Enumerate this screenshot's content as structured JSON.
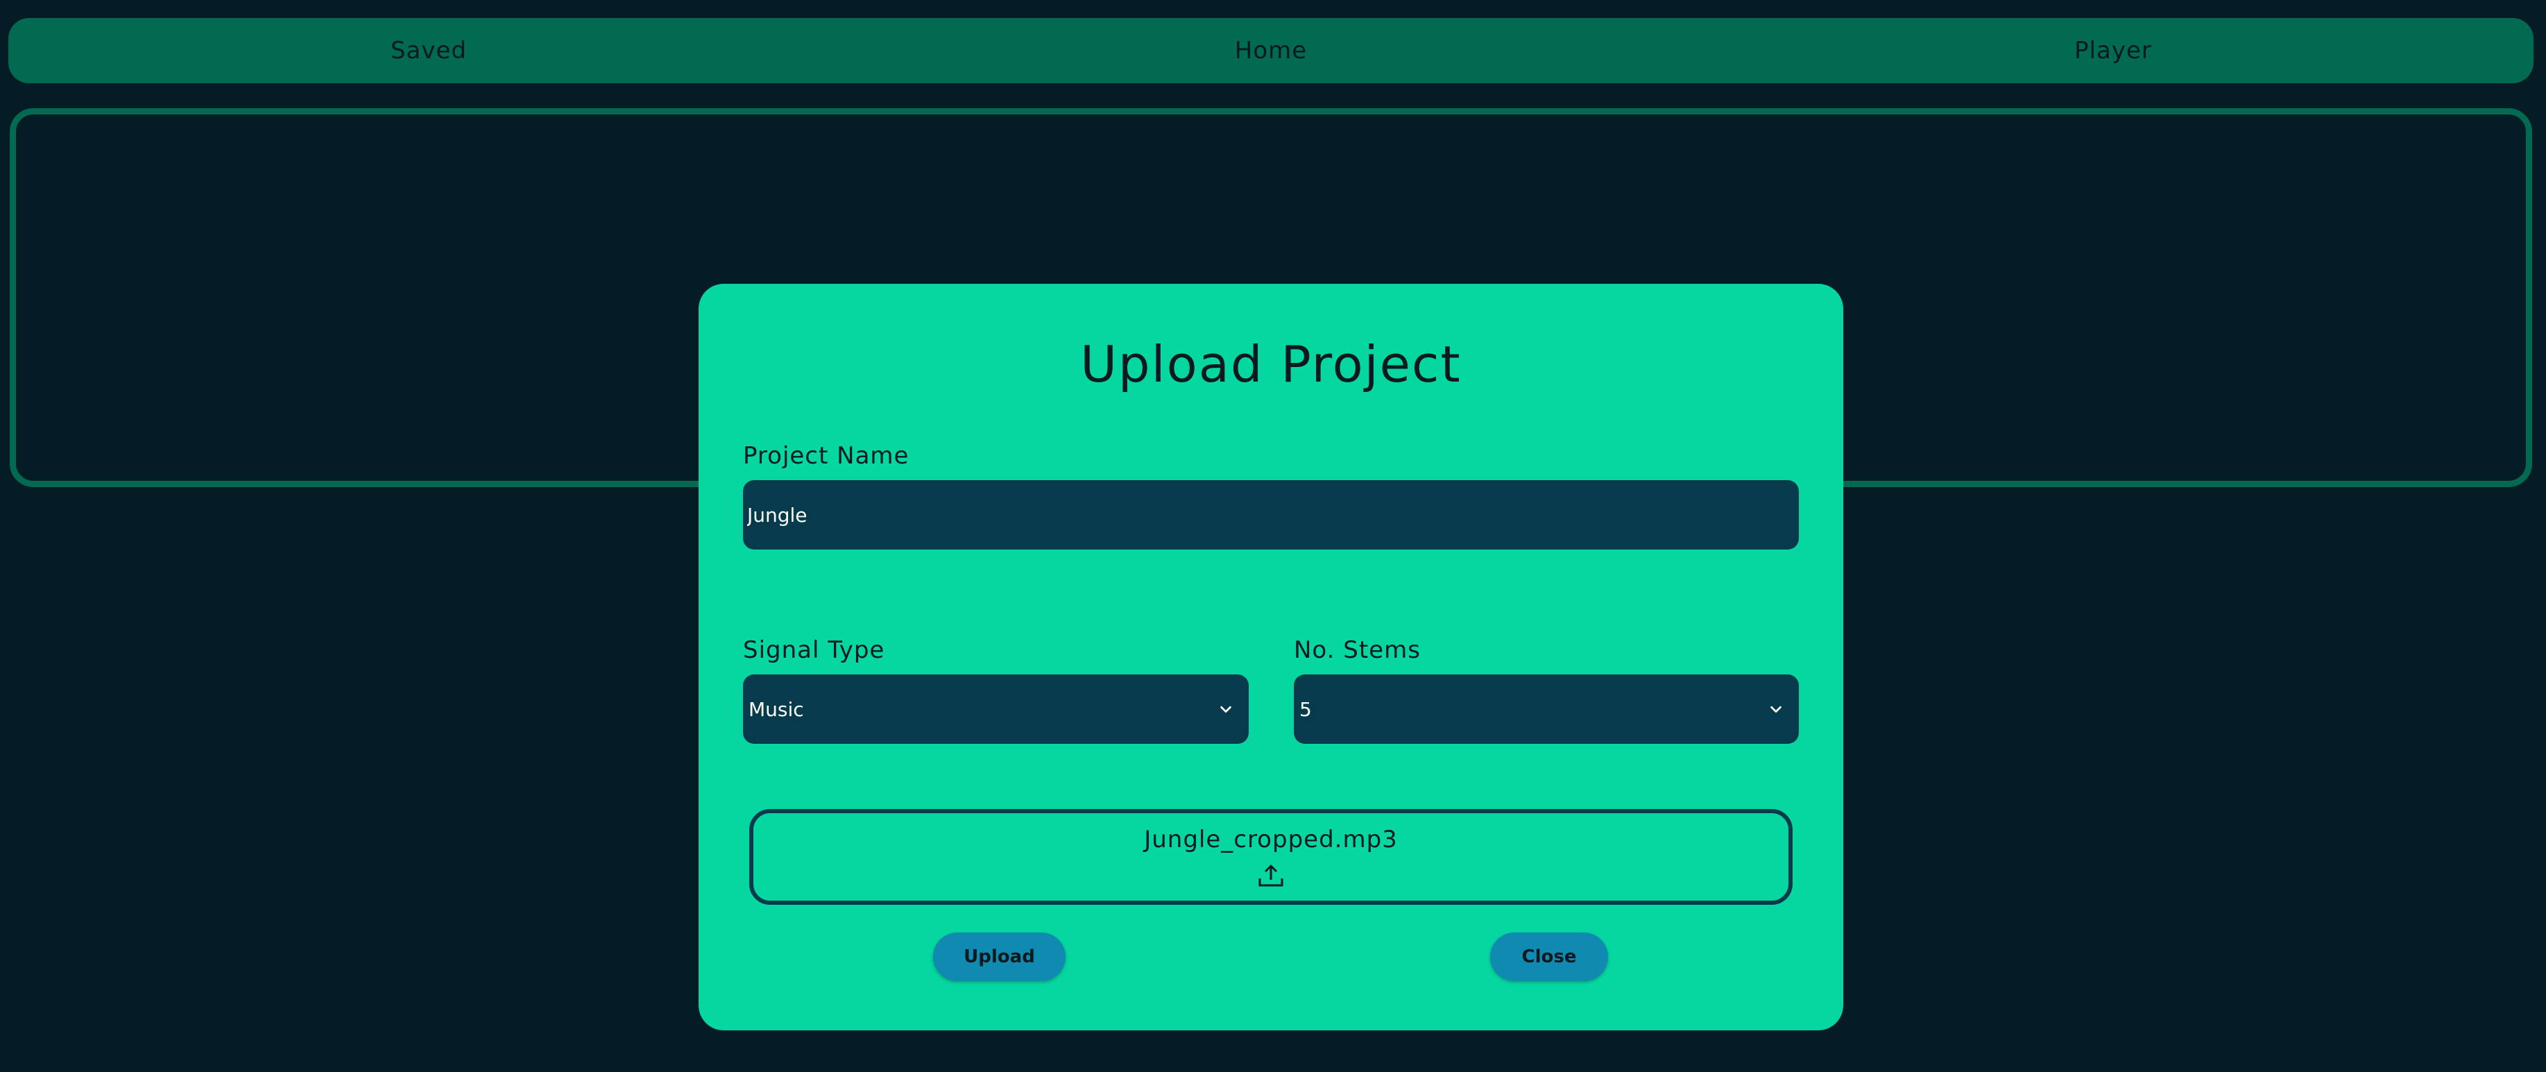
{
  "nav": {
    "items": [
      {
        "label": "Saved"
      },
      {
        "label": "Home"
      },
      {
        "label": "Player"
      }
    ]
  },
  "modal": {
    "title": "Upload Project",
    "project_name": {
      "label": "Project Name",
      "value": "Jungle"
    },
    "signal_type": {
      "label": "Signal Type",
      "selected": "Music"
    },
    "num_stems": {
      "label": "No. Stems",
      "selected": "5"
    },
    "file": {
      "filename": "Jungle_cropped.mp3",
      "icon": "upload-icon"
    },
    "upload_label": "Upload",
    "close_label": "Close"
  },
  "colors": {
    "background": "#041c25",
    "nav": "#036a52",
    "modal": "#06d6a0",
    "input": "#073b4c",
    "button": "#118ab2"
  }
}
